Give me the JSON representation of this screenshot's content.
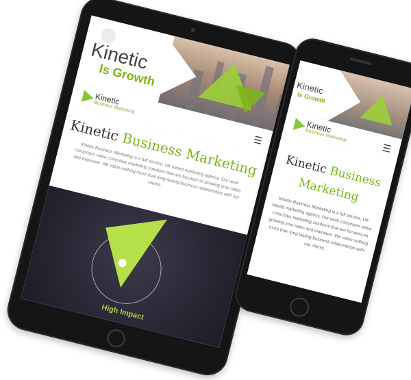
{
  "tablet": {
    "hero_title": "Kinetic",
    "hero_tagline": "Is Growth",
    "nav_logo_name": "Kinetic",
    "nav_logo_sub": "Business Marketing",
    "menu_icon": "☰",
    "heading_plain": "Kinetic ",
    "heading_accent": "Business Marketing",
    "body": "Kinetic Business Marketing is a full service, UK based marketing agency. Our work comprises value conscious marketing solutions that are focused on growing your sales and exposure. We value nothing more than long lasting business relationships with our clients.",
    "impact_label": "High Impact"
  },
  "phone": {
    "hero_title": "Kinetic",
    "hero_tagline": "Is Growth",
    "nav_logo_name": "Kinetic",
    "nav_logo_sub": "Business Marketing",
    "menu_icon": "☰",
    "heading_plain": "Kinetic ",
    "heading_accent": "Business Marketing",
    "body": "Kinetic Business Marketing is a full service, UK based marketing agency. Our work comprises value conscious marketing solutions that are focused on growing your sales and exposure. We value nothing more than long lasting business relationships with our clients."
  },
  "colors": {
    "accent_green": "#7cb518",
    "triangle_green": "#a6d640",
    "dark_bg": "#2a2735"
  },
  "icons": [
    "menu-icon",
    "globe-icon",
    "logo-triangle-icon"
  ]
}
